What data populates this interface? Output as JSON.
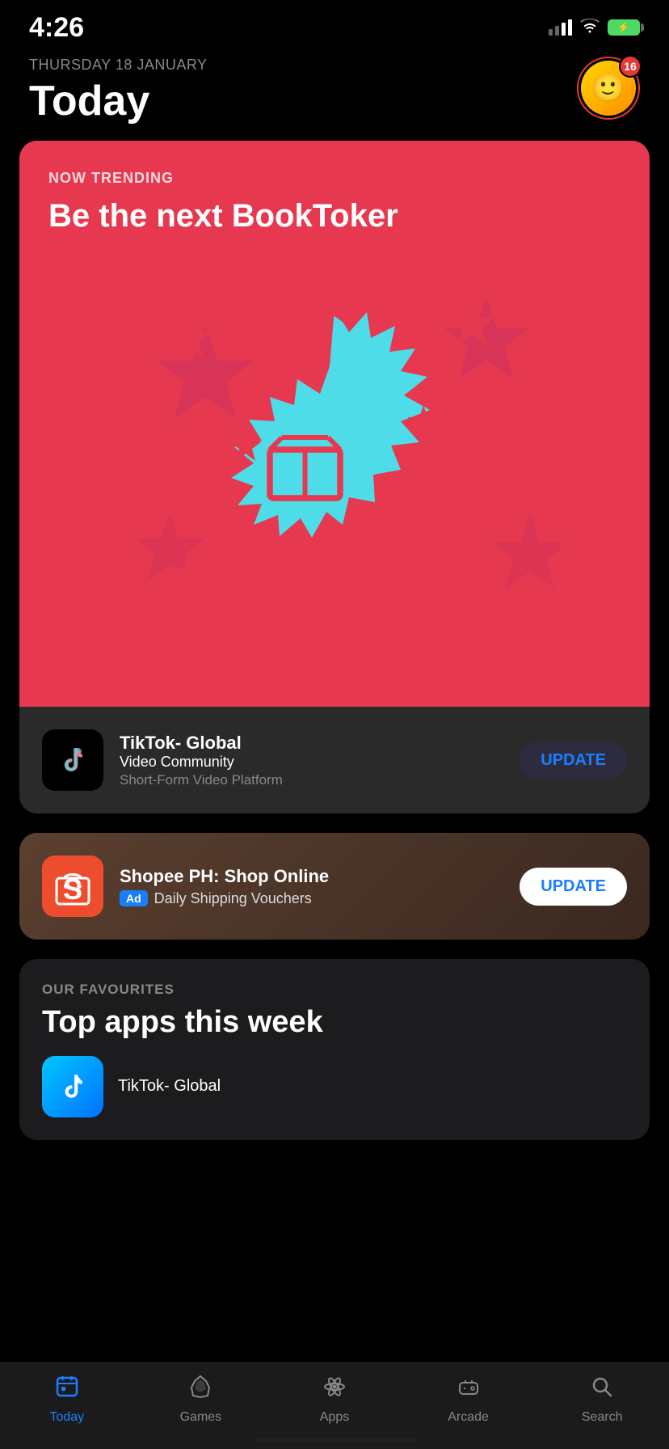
{
  "statusBar": {
    "time": "4:26",
    "batteryIcon": "⚡",
    "notificationCount": "16"
  },
  "header": {
    "dateLabel": "THURSDAY 18 JANUARY",
    "pageTitle": "Today",
    "avatarEmoji": "🙂"
  },
  "featuredCard": {
    "trendingLabel": "NOW TRENDING",
    "title": "Be the next BookToker",
    "appName": "TikTok- Global",
    "appSubtitle": "Video Community",
    "appTagline": "Short-Form Video Platform",
    "updateLabel": "UPDATE"
  },
  "adCard": {
    "appName": "Shopee PH: Shop Online",
    "adBadge": "Ad",
    "tagline": "Daily Shipping Vouchers",
    "updateLabel": "UPDATE",
    "appIcon": "S"
  },
  "favouritesSection": {
    "sectionLabel": "OUR FAVOURITES",
    "sectionTitle": "Top apps this week",
    "appName": "TikTok- Global"
  },
  "tabBar": {
    "tabs": [
      {
        "label": "Today",
        "active": true,
        "icon": "📋"
      },
      {
        "label": "Games",
        "active": false,
        "icon": "🚀"
      },
      {
        "label": "Apps",
        "active": false,
        "icon": "🗂"
      },
      {
        "label": "Arcade",
        "active": false,
        "icon": "🕹"
      },
      {
        "label": "Search",
        "active": false,
        "icon": "🔍"
      }
    ]
  }
}
